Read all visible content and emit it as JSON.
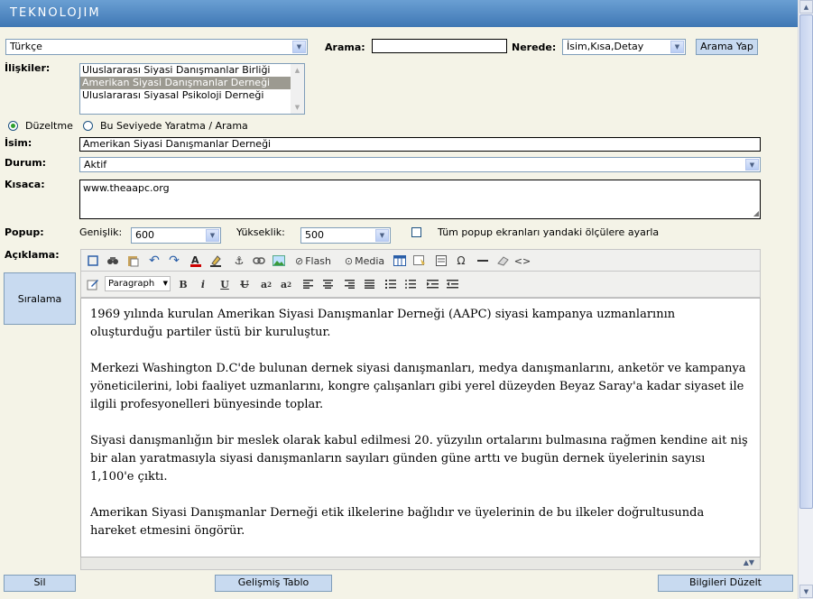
{
  "header": {
    "logo": "TEKNOLOJIM"
  },
  "language": {
    "value": "Türkçe"
  },
  "search": {
    "label": "Arama:",
    "value": "",
    "where_label": "Nerede:",
    "where_value": "İsim,Kısa,Detay",
    "button": "Arama Yap"
  },
  "relations": {
    "label": "İlişkiler:",
    "items": [
      "Uluslararası Siyasi Danışmanlar Birliği",
      "Amerikan Siyasi Danışmanlar Derneği",
      "Uluslararası Siyasal Psikoloji Derneği"
    ],
    "selected_index": 1
  },
  "mode": {
    "edit_label": "Düzeltme",
    "create_label": "Bu Seviyede Yaratma / Arama",
    "selected": "edit"
  },
  "fields": {
    "name_label": "İsim:",
    "name_value": "Amerikan Siyasi Danışmanlar Derneği",
    "status_label": "Durum:",
    "status_value": "Aktif",
    "short_label": "Kısaca:",
    "short_value": "www.theaapc.org",
    "popup_label": "Popup:",
    "width_label": "Genişlik:",
    "width_value": "600",
    "height_label": "Yükseklik:",
    "height_value": "500",
    "all_popups_label": "Tüm popup ekranları yandaki ölçülere ayarla",
    "desc_label": "Açıklama:"
  },
  "sidebar": {
    "sort_button": "Sıralama"
  },
  "toolbar": {
    "flash": "Flash",
    "media": "Media",
    "format": "Paragraph"
  },
  "editor": {
    "paragraphs": [
      "1969 yılında kurulan Amerikan Siyasi Danışmanlar Derneği (AAPC) siyasi kampanya uzmanlarının oluşturduğu partiler üstü bir kuruluştur.",
      "Merkezi Washington D.C'de bulunan dernek siyasi danışmanları, medya danışmanlarını, anketör ve kampanya yöneticilerini, lobi faaliyet uzmanlarını, kongre çalışanları gibi yerel düzeyden Beyaz Saray'a kadar siyaset ile ilgili profesyonelleri bünyesinde toplar.",
      "Siyasi danışmanlığın bir meslek olarak kabul edilmesi 20. yüzyılın ortalarını bulmasına rağmen kendine ait niş bir alan yaratmasıyla siyasi danışmanların sayıları günden güne arttı ve bugün dernek üyelerinin sayısı 1,100'e çıktı.",
      "Amerikan Siyasi Danışmanlar Derneği etik ilkelerine bağlıdır ve üyelerinin de bu ilkeler doğrultusunda hareket etmesini öngörür."
    ]
  },
  "footer": {
    "delete": "Sil",
    "advanced_table": "Gelişmiş Tablo",
    "update": "Bilgileri Düzelt"
  }
}
